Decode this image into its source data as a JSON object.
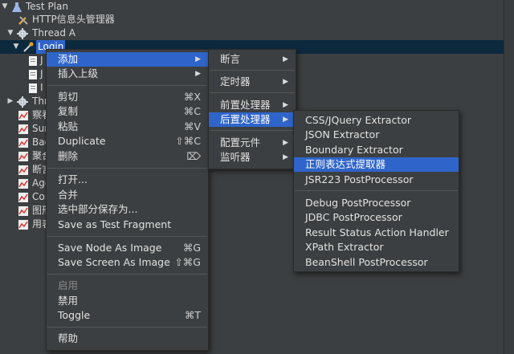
{
  "tree": {
    "items": [
      {
        "label": "Test Plan",
        "icon": "flask-icon"
      },
      {
        "label": "HTTP信息头管理器",
        "icon": "wrench-icon"
      },
      {
        "label": "Thread A",
        "icon": "gear-icon"
      },
      {
        "label": "Login",
        "icon": "pipette-icon"
      },
      {
        "label": "J",
        "icon": "doc-icon"
      },
      {
        "label": "J",
        "icon": "doc-icon"
      },
      {
        "label": "I",
        "icon": "doc-icon"
      },
      {
        "label": "Thr",
        "icon": "gear-icon"
      },
      {
        "label": "察看",
        "icon": "graph-icon"
      },
      {
        "label": "Sun",
        "icon": "graph-icon"
      },
      {
        "label": "Bac",
        "icon": "graph-icon"
      },
      {
        "label": "聚合",
        "icon": "graph-icon"
      },
      {
        "label": "断言",
        "icon": "graph-icon"
      },
      {
        "label": "Agg",
        "icon": "graph-icon"
      },
      {
        "label": "Cor",
        "icon": "graph-icon"
      },
      {
        "label": "图形",
        "icon": "graph-icon"
      },
      {
        "label": "用表",
        "icon": "graph-icon"
      }
    ]
  },
  "context_menu": {
    "items": [
      {
        "label": "添加",
        "shortcut": "",
        "submenu": true,
        "highlight": true
      },
      {
        "label": "插入上级",
        "shortcut": "",
        "submenu": true
      },
      {
        "label": "剪切",
        "shortcut": "⌘X"
      },
      {
        "label": "复制",
        "shortcut": "⌘C"
      },
      {
        "label": "粘贴",
        "shortcut": "⌘V"
      },
      {
        "label": "Duplicate",
        "shortcut": "⇧⌘C"
      },
      {
        "label": "删除",
        "shortcut": "⌦"
      },
      {
        "label": "打开...",
        "shortcut": ""
      },
      {
        "label": "合并",
        "shortcut": ""
      },
      {
        "label": "选中部分保存为...",
        "shortcut": ""
      },
      {
        "label": "Save as Test Fragment",
        "shortcut": ""
      },
      {
        "label": "Save Node As Image",
        "shortcut": "⌘G"
      },
      {
        "label": "Save Screen As Image",
        "shortcut": "⇧⌘G"
      },
      {
        "label": "启用",
        "shortcut": "",
        "disabled": true
      },
      {
        "label": "禁用",
        "shortcut": ""
      },
      {
        "label": "Toggle",
        "shortcut": "⌘T"
      },
      {
        "label": "帮助",
        "shortcut": ""
      }
    ]
  },
  "add_submenu": {
    "items": [
      {
        "label": "断言",
        "submenu": true
      },
      {
        "label": "定时器",
        "submenu": true
      },
      {
        "label": "前置处理器",
        "submenu": true
      },
      {
        "label": "后置处理器",
        "submenu": true,
        "highlight": true
      },
      {
        "label": "配置元件",
        "submenu": true
      },
      {
        "label": "监听器",
        "submenu": true
      }
    ]
  },
  "post_processor_submenu": {
    "items": [
      {
        "label": "CSS/JQuery Extractor"
      },
      {
        "label": "JSON Extractor"
      },
      {
        "label": "Boundary Extractor"
      },
      {
        "label": "正则表达式提取器",
        "highlight": true
      },
      {
        "label": "JSR223 PostProcessor"
      },
      {
        "label": "Debug PostProcessor"
      },
      {
        "label": "JDBC PostProcessor"
      },
      {
        "label": "Result Status Action Handler"
      },
      {
        "label": "XPath Extractor"
      },
      {
        "label": "BeanShell PostProcessor"
      }
    ]
  },
  "colors": {
    "background": "#3c3f41",
    "highlight": "#2f65ca",
    "selected_row": "#0d293e",
    "text": "#d6d6d6"
  }
}
